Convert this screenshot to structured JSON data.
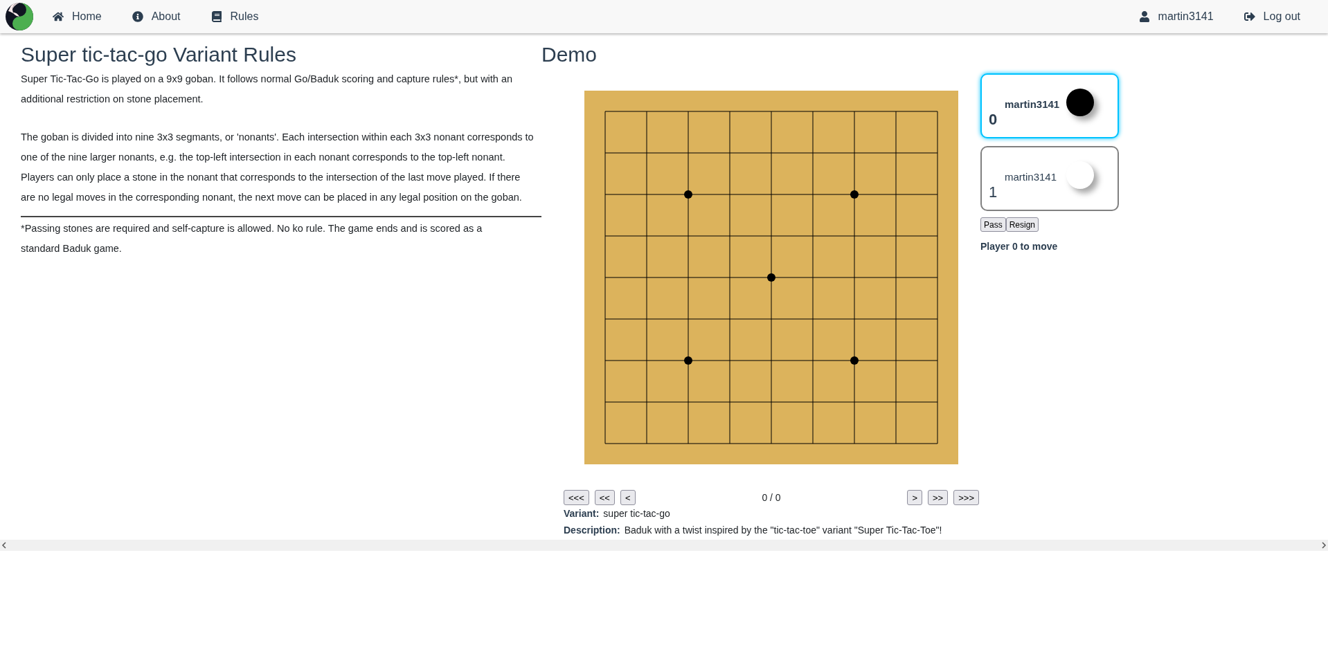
{
  "navbar": {
    "left": [
      {
        "kind": "home",
        "label": "Home"
      },
      {
        "kind": "about",
        "label": "About"
      },
      {
        "kind": "rules",
        "label": "Rules"
      }
    ],
    "right": [
      {
        "kind": "user",
        "label": "martin3141"
      },
      {
        "kind": "logout",
        "label": "Log out"
      }
    ]
  },
  "rules": {
    "title": "Super tic-tac-go Variant Rules",
    "paragraphs": [
      "Super Tic-Tac-Go is played on a 9x9 goban. It follows normal Go/Baduk scoring and capture rules*, but with an additional restriction on stone placement.",
      "The goban is divided into nine 3x3 segmants, or 'nonants'. Each intersection within each 3x3 nonant corresponds to one of the nine larger nonants, e.g. the top-left intersection in each nonant corresponds to the top-left nonant. Players can only place a stone in the nonant that corresponds to the intersection of the last move played. If there are no legal moves in the corresponding nonant, the next move can be placed in any legal position on the goban."
    ],
    "footnote": "*Passing stones are required and self-capture is allowed. No ko rule. The game ends and is scored as a standard Baduk game."
  },
  "demo": {
    "title": "Demo",
    "players": [
      {
        "score": "0",
        "name": "martin3141",
        "color": "#000000",
        "selected": true
      },
      {
        "score": "1",
        "name": "martin3141",
        "color": "#ffffff",
        "selected": false
      }
    ],
    "buttons": [
      "Pass",
      "Resign"
    ],
    "status": "Player 0 to move",
    "navigation": {
      "back": [
        "<<<",
        "<<",
        "<"
      ],
      "counter": "0 / 0",
      "forward": [
        ">",
        ">>",
        ">>>"
      ]
    },
    "info": [
      {
        "label": "Variant:",
        "value": "super tic-tac-go"
      },
      {
        "label": "Description:",
        "value": "Baduk with a twist inspired by the \"tic-tac-toe\" variant \"Super Tic-Tac-Toe\"!"
      }
    ]
  }
}
